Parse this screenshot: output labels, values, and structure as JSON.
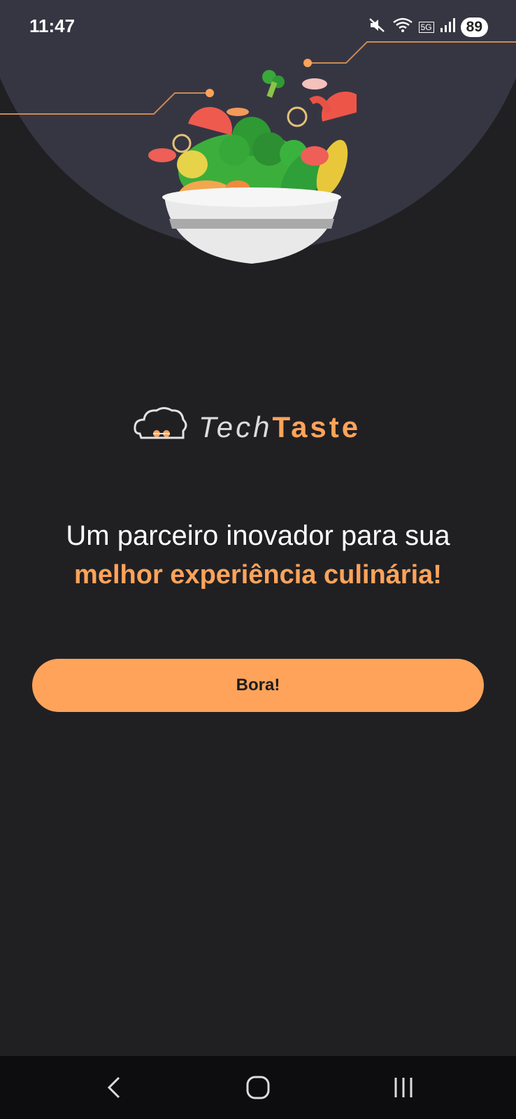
{
  "status_bar": {
    "time": "11:47",
    "network": "5G",
    "battery": "89",
    "icons": [
      "mute-icon",
      "wifi-icon",
      "signal-icon",
      "battery-icon"
    ]
  },
  "brand": {
    "name_part1": "Tech",
    "name_part2": "Taste",
    "logo_icon": "chef-hat-icon"
  },
  "tagline": {
    "line1": "Um parceiro inovador para sua",
    "line2": "melhor experiência culinária!"
  },
  "cta": {
    "label": "Bora!"
  },
  "nav_bar": {
    "items": [
      "back-icon",
      "home-icon",
      "recents-icon"
    ]
  },
  "colors": {
    "background": "#202023",
    "hero": "#363642",
    "accent": "#ffa35a",
    "text": "#ffffff"
  }
}
